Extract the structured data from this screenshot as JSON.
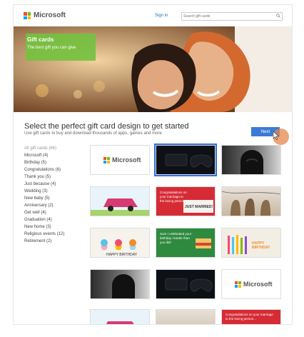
{
  "header": {
    "brand": "Microsoft",
    "signin": "Sign in",
    "search_placeholder": "Search gift cards"
  },
  "hero": {
    "title": "Gift cards",
    "subtitle": "The best gift you can give"
  },
  "main": {
    "headline": "Select the perfect gift card design to get started",
    "subhead": "Use gift cards to buy and download thousands of apps, games and more",
    "next_label": "Next"
  },
  "sidebar": {
    "items": [
      "All gift cards (66)",
      "Microsoft (4)",
      "Birthday (5)",
      "Congratulations (6)",
      "Thank you (5)",
      "Just because (4)",
      "Wedding (3)",
      "New baby (5)",
      "Anniversary (2)",
      "Get well (4)",
      "Graduation (4)",
      "New home (3)",
      "Religious events (12)",
      "Retirement (2)"
    ]
  },
  "tiles": {
    "ms1_brand": "Microsoft",
    "married_red_text": "Congratulations on your marriage to the loving person...",
    "married_sign": "JUST MARRIED!",
    "cupcakes_text": "HAPPY BIRTHDAY",
    "green_text": "Sure I celebrated your birthday. Harder than you did!",
    "happy_birthday": "HAPPY BIRTHDAY",
    "ms2_brand": "Microsoft",
    "bottom_red_text": "Congratulations on your marriage to the loving person..."
  },
  "colors": {
    "ms_red": "#f25022",
    "ms_green": "#7fba00",
    "ms_blue": "#00a4ef",
    "ms_yellow": "#ffb900",
    "accent_blue": "#3a7bd5",
    "hero_green": "#74c140"
  }
}
